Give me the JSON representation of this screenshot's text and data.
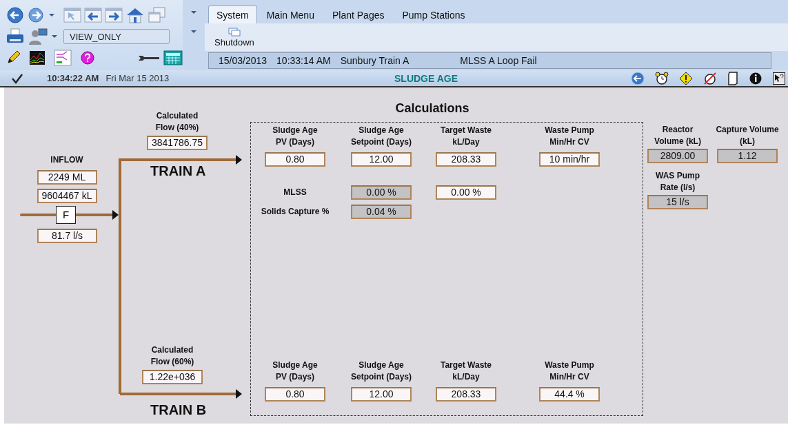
{
  "toolbar": {
    "user": "VIEW_ONLY"
  },
  "tabs": [
    {
      "label": "System",
      "selected": true
    },
    {
      "label": "Main Menu",
      "selected": false
    },
    {
      "label": "Plant Pages",
      "selected": false
    },
    {
      "label": "Pump Stations",
      "selected": false
    }
  ],
  "ribbon": {
    "button": "Shutdown"
  },
  "alarm_bar": {
    "date": "15/03/2013",
    "time": "10:33:14 AM",
    "area": "Sunbury Train A",
    "message": "MLSS A Loop Fail"
  },
  "status_bar": {
    "time": "10:34:22 AM",
    "date": "Fri Mar 15 2013",
    "page_title": "SLUDGE AGE"
  },
  "inflow": {
    "title": "INFLOW",
    "totals": [
      "2249 ML",
      "9604467 kL"
    ],
    "instrument": "F",
    "rate": "81.7 l/s"
  },
  "trains": [
    {
      "name": "TRAIN A",
      "flow_label": "Calculated\nFlow (40%)",
      "flow_value": "3841786.75"
    },
    {
      "name": "TRAIN B",
      "flow_label": "Calculated\nFlow (60%)",
      "flow_value": "1.22e+036"
    }
  ],
  "calculations": {
    "title": "Calculations",
    "train_a": {
      "columns": [
        {
          "label": "Sludge Age\nPV (Days)",
          "value": "0.80",
          "readonly": false
        },
        {
          "label": "Sludge Age\nSetpoint (Days)",
          "value": "12.00",
          "readonly": false
        },
        {
          "label": "Target Waste\nkL/Day",
          "value": "208.33",
          "readonly": false
        },
        {
          "label": "Waste Pump\nMin/Hr CV",
          "value": "10 min/hr",
          "readonly": false
        }
      ],
      "rows": [
        {
          "label": "MLSS",
          "values": [
            {
              "value": "0.00 %",
              "readonly": true
            },
            {
              "value": "0.00 %",
              "readonly": false
            }
          ]
        },
        {
          "label": "Solids Capture %",
          "values": [
            {
              "value": "0.04 %",
              "readonly": true
            }
          ]
        }
      ]
    },
    "train_b": {
      "columns": [
        {
          "label": "Sludge Age\nPV (Days)",
          "value": "0.80",
          "readonly": false
        },
        {
          "label": "Sludge Age\nSetpoint (Days)",
          "value": "12.00",
          "readonly": false
        },
        {
          "label": "Target Waste\nkL/Day",
          "value": "208.33",
          "readonly": false
        },
        {
          "label": "Waste Pump\nMin/Hr CV",
          "value": "44.4 %",
          "readonly": false
        }
      ]
    }
  },
  "reactor": [
    {
      "label": "Reactor\nVolume (kL)",
      "value": "2809.00",
      "readonly": true
    },
    {
      "label": "Capture Volume\n(kL)",
      "value": "1.12",
      "readonly": true
    },
    {
      "label": "WAS Pump\nRate (l/s)",
      "value": "15 l/s",
      "readonly": true
    }
  ]
}
